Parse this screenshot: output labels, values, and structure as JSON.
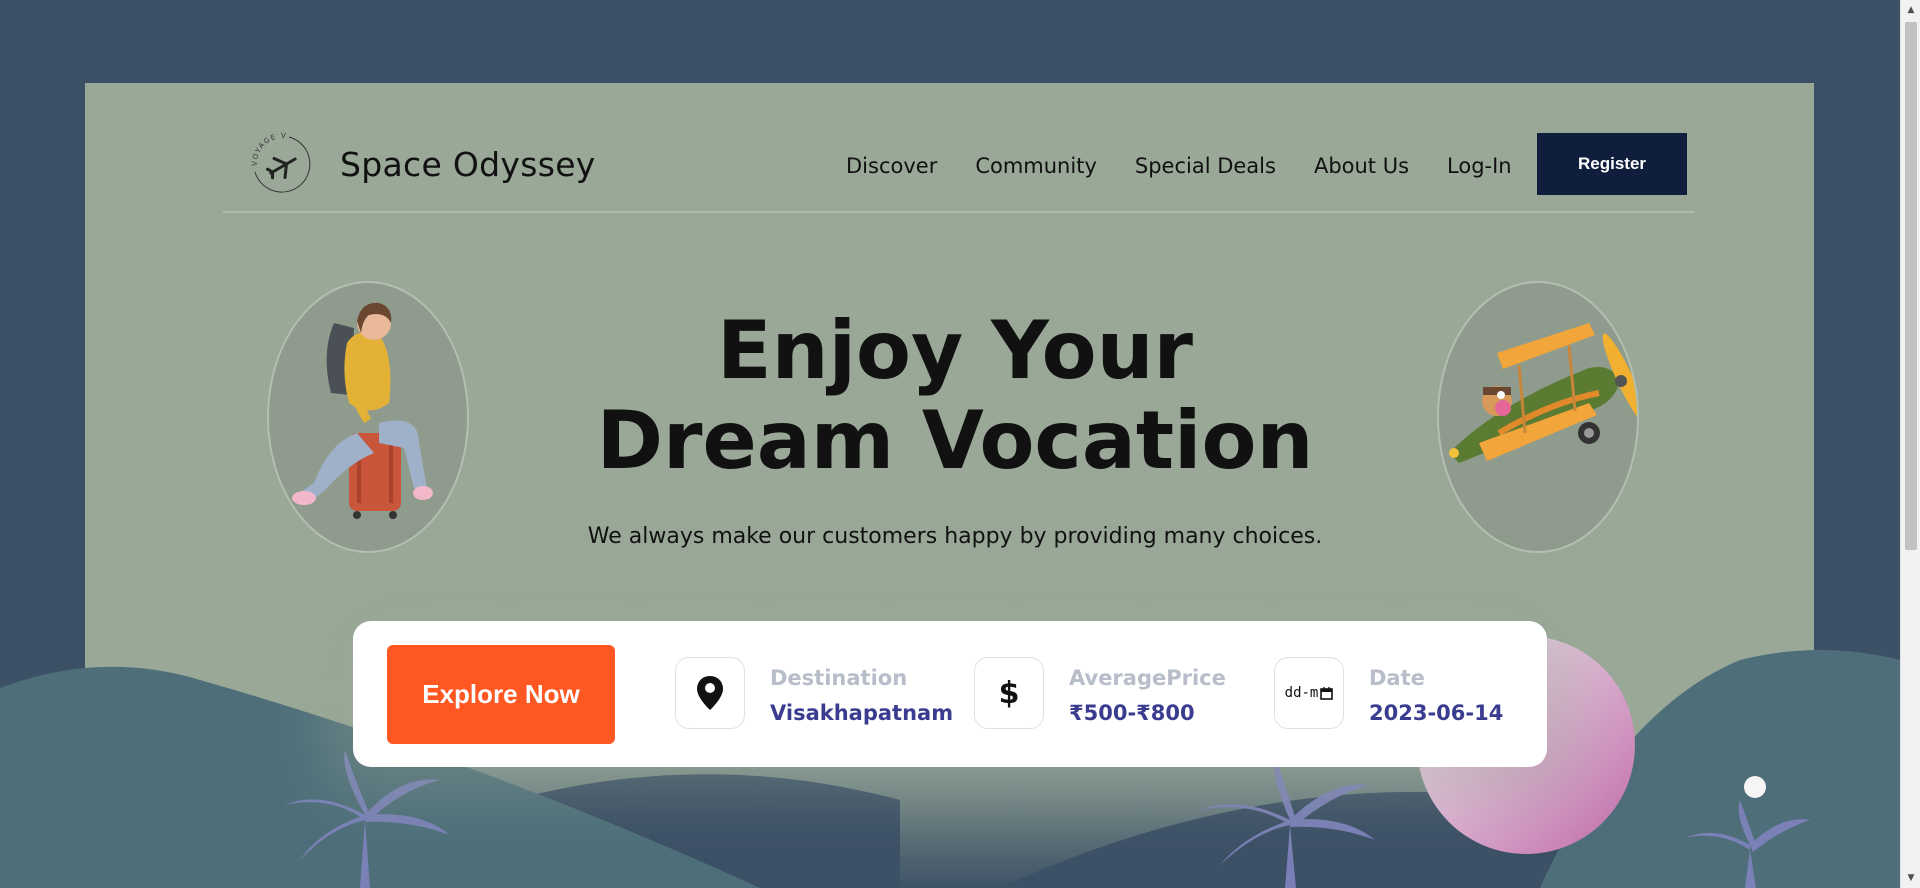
{
  "brand": {
    "name": "Space Odyssey",
    "logo_text": "VOYAGE VIA"
  },
  "nav": {
    "items": [
      "Discover",
      "Community",
      "Special Deals",
      "About Us",
      "Log-In"
    ],
    "register_label": "Register"
  },
  "hero": {
    "headline_line1": "Enjoy Your",
    "headline_line2": "Dream Vocation",
    "subheadline": "We always make our customers happy by providing many choices."
  },
  "search": {
    "explore_label": "Explore Now",
    "destination_label": "Destination",
    "destination_value": "Visakhapatnam",
    "price_label": "AveragePrice",
    "price_value": "₹500-₹800",
    "price_icon": "$",
    "date_label": "Date",
    "date_value": "2023-06-14",
    "date_input_placeholder": "dd-m"
  },
  "colors": {
    "page_bg": "#3c5066",
    "hero_bg": "#9aa898",
    "register_bg": "#0f1e3d",
    "explore_bg": "#ff5722",
    "field_value": "#3a3d8f",
    "field_label": "#b7bdc9"
  },
  "icons": {
    "logo": "airplane-logo-icon",
    "destination": "map-pin-icon",
    "price": "dollar-icon",
    "date": "calendar-icon"
  }
}
